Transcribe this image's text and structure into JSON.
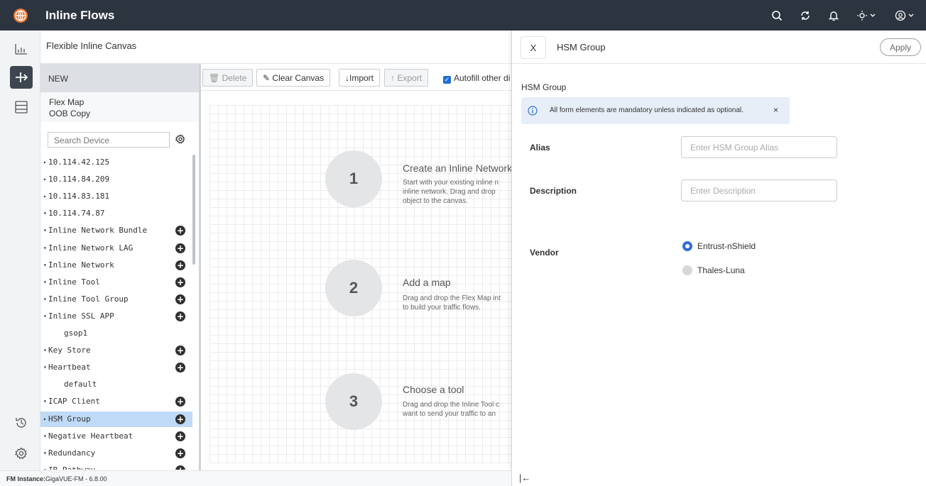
{
  "app": {
    "title": "Inline Flows"
  },
  "subheader": {
    "title": "Flexible Inline Canvas"
  },
  "tree_panel": {
    "new_label": "NEW",
    "flex_map_label": "Flex Map",
    "oob_copy_label": "OOB Copy",
    "search_placeholder": "Search Device",
    "items": [
      {
        "label": "10.114.42.125",
        "arrow": "▸",
        "indent": 0,
        "plus": false
      },
      {
        "label": "10.114.84.209",
        "arrow": "▸",
        "indent": 0,
        "plus": false
      },
      {
        "label": "10.114.83.181",
        "arrow": "▸",
        "indent": 0,
        "plus": false
      },
      {
        "label": "10.114.74.87",
        "arrow": "▾",
        "indent": 0,
        "plus": false
      },
      {
        "label": "Inline Network Bundle",
        "arrow": "▾",
        "indent": 1,
        "plus": true
      },
      {
        "label": "Inline Network LAG",
        "arrow": "▾",
        "indent": 1,
        "plus": true
      },
      {
        "label": "Inline Network",
        "arrow": "▾",
        "indent": 1,
        "plus": true
      },
      {
        "label": "Inline Tool",
        "arrow": "▾",
        "indent": 1,
        "plus": true
      },
      {
        "label": "Inline Tool Group",
        "arrow": "▾",
        "indent": 1,
        "plus": true
      },
      {
        "label": "Inline SSL APP",
        "arrow": "▾",
        "indent": 1,
        "plus": true
      },
      {
        "label": "gsop1",
        "arrow": "",
        "indent": 2,
        "plus": false
      },
      {
        "label": "Key Store",
        "arrow": "▾",
        "indent": 1,
        "plus": true
      },
      {
        "label": "Heartbeat",
        "arrow": "▾",
        "indent": 1,
        "plus": true
      },
      {
        "label": "default",
        "arrow": "",
        "indent": 2,
        "plus": false
      },
      {
        "label": "ICAP Client",
        "arrow": "▾",
        "indent": 1,
        "plus": true
      },
      {
        "label": "HSM Group",
        "arrow": "▸",
        "indent": 1,
        "plus": true,
        "selected": true
      },
      {
        "label": "Negative Heartbeat",
        "arrow": "▾",
        "indent": 1,
        "plus": true
      },
      {
        "label": "Redundancy",
        "arrow": "▾",
        "indent": 1,
        "plus": true
      },
      {
        "label": "IB Pathway",
        "arrow": "▾",
        "indent": 1,
        "plus": true
      }
    ]
  },
  "toolbar": {
    "delete_label": "Delete",
    "clear_label": "Clear Canvas",
    "import_label": "Import",
    "export_label": "Export",
    "autofill_label": "Autofill other di"
  },
  "steps": [
    {
      "num": "1",
      "title": "Create an Inline Network",
      "desc": [
        "Start with your existing inline n",
        "inline network. Drag and drop",
        "object to the canvas."
      ]
    },
    {
      "num": "2",
      "title": "Add a map",
      "desc": [
        "Drag and drop the Flex Map int",
        "to build your traffic flows."
      ]
    },
    {
      "num": "3",
      "title": "Choose a tool",
      "desc": [
        "Drag and drop the Inline Tool c",
        "want to send your traffic to an"
      ]
    }
  ],
  "drawer": {
    "close_label": "X",
    "title": "HSM Group",
    "apply_label": "Apply",
    "section_label": "HSM Group",
    "info_text": "All form elements are mandatory unless indicated as optional.",
    "info_close": "×",
    "alias_label": "Alias",
    "alias_placeholder": "Enter HSM Group Alias",
    "description_label": "Description",
    "description_placeholder": "Enter Description",
    "vendor_label": "Vendor",
    "vendor_options": [
      {
        "label": "Entrust-nShield",
        "selected": true
      },
      {
        "label": "Thales-Luna",
        "selected": false
      }
    ],
    "collapse_label": "|←"
  },
  "footer": {
    "instance_label": "FM Instance:",
    "instance_value": "GigaVUE-FM - 6.8.00"
  },
  "colors": {
    "topbar": "#2c3440",
    "accent": "#2f6fd6",
    "selected_row": "#bfdaf7"
  }
}
